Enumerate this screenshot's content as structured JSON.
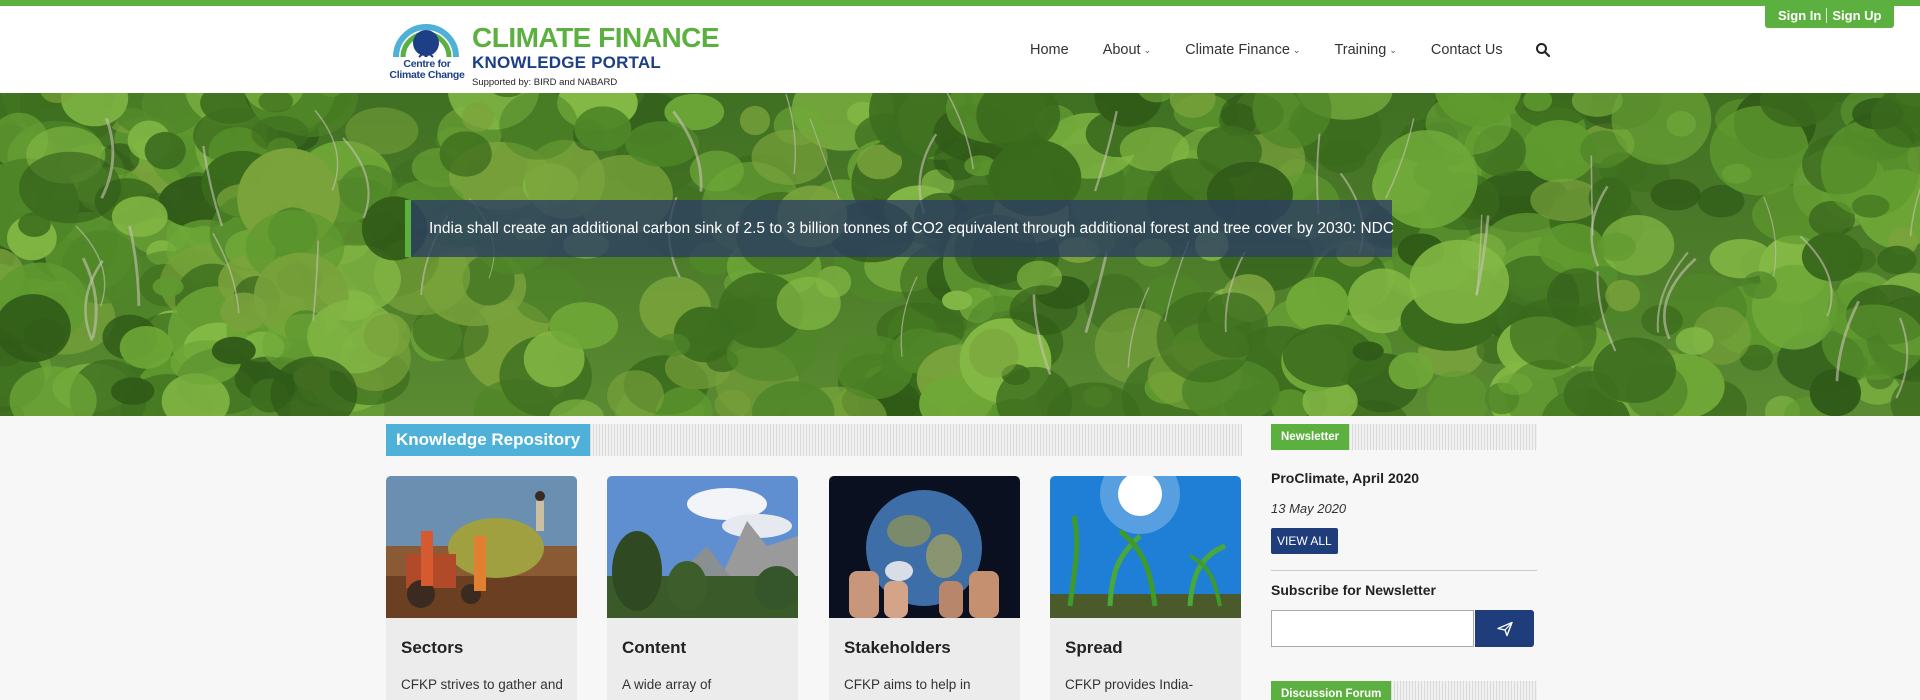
{
  "auth": {
    "sign_in": "Sign In",
    "sign_up": "Sign Up"
  },
  "logo": {
    "title_line1": "CLIMATE FINANCE",
    "title_line2": "KNOWLEDGE PORTAL",
    "supported_by": "Supported by: BIRD and NABARD",
    "centre_line1": "Centre for",
    "centre_line2": "Climate Change"
  },
  "nav": {
    "home": "Home",
    "about": "About",
    "climate_finance": "Climate Finance",
    "training": "Training",
    "contact": "Contact Us",
    "search_icon": "search-icon"
  },
  "hero": {
    "quote": "India shall create an additional carbon sink of 2.5 to 3 billion tonnes of CO2 equivalent through additional forest and tree cover by 2030: NDC"
  },
  "knowledge_repository": {
    "heading": "Knowledge Repository",
    "cards": [
      {
        "title": "Sectors",
        "desc": "CFKP strives to gather and"
      },
      {
        "title": "Content",
        "desc": "A wide array of"
      },
      {
        "title": "Stakeholders",
        "desc": "CFKP aims to help in"
      },
      {
        "title": "Spread",
        "desc": "CFKP provides India-"
      }
    ]
  },
  "sidebar": {
    "newsletter_heading": "Newsletter",
    "newsletter_title": "ProClimate, April 2020",
    "newsletter_date": "13 May 2020",
    "view_all": "VIEW ALL",
    "subscribe_title": "Subscribe for Newsletter",
    "subscribe_icon": "send-icon",
    "forum_heading": "Discussion Forum"
  },
  "colors": {
    "brand_green": "#5cb03f",
    "brand_blue": "#1c3f86",
    "repository_blue": "#4fb0d8",
    "button_navy": "#1f3d7a"
  }
}
